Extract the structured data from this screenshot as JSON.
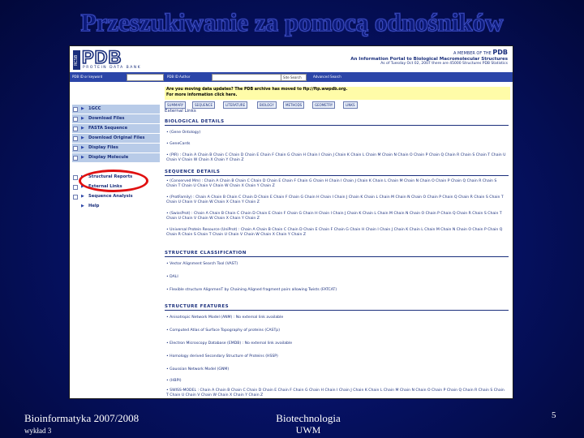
{
  "slide": {
    "title": "Przeszukiwanie za pomocą odnośników",
    "footer_left": "Bioinformatyka 2007/2008",
    "footer_left_sub": "wykład 3",
    "footer_center": "Biotechnologia",
    "footer_center_sub": "UWM",
    "page_number": "5"
  },
  "screenshot": {
    "logo_side": "RCSB",
    "logo": "PDB",
    "logo_sub": "PROTEIN DATA BANK",
    "tagline_1": "A MEMBER OF THE",
    "tagline_mark": "PDB",
    "tagline_2": "An Information Portal to Biological Macromolecular Structures",
    "links_row": "As of Tuesday Oct 02, 2007   there are 45000 Structures   PDB Statistics",
    "bluebar_site": "PDB ID or keyword",
    "bluebar_inp1": "",
    "bluebar_lbl1": "PDB ID   Author",
    "bluebar_inp2": "",
    "bluebar_btn": "Site Search",
    "bluebar_adv": "Advanced Search",
    "sidebar": [
      {
        "label": "1GCC",
        "highlight": false
      },
      {
        "label": "Download Files",
        "highlight": false
      },
      {
        "label": "FASTA Sequence",
        "highlight": false
      },
      {
        "label": "Download Original Files",
        "highlight": false
      },
      {
        "label": "Display Files",
        "highlight": false
      },
      {
        "label": "Display Molecule",
        "highlight": false
      },
      {
        "label": "Structural Reports",
        "highlight": false
      },
      {
        "label": "External Links",
        "highlight": true
      },
      {
        "label": "Sequence Analysis",
        "highlight": false
      },
      {
        "label": "Help",
        "highlight": false
      }
    ],
    "notice_1": "Are you moving data updates? The PDB archive has moved to ftp://ftp.wwpdb.org.",
    "notice_2": "For more information click here.",
    "tabs": [
      "SUMMARY",
      "SEQUENCE",
      "LITERATURE",
      "BIOLOGY",
      "METHODS",
      "GEOMETRY",
      "LINKS"
    ],
    "page_heading": "External Links",
    "sections": [
      {
        "title": "BIOLOGICAL DETAILS",
        "lines": [
          "• (Gene Ontology)",
          "• GeneCards",
          "• (PIR) : Chain A  Chain B  Chain C  Chain D  Chain E  Chain F  Chain G  Chain H  Chain I  Chain J  Chain K  Chain L  Chain M  Chain N  Chain O  Chain P  Chain Q  Chain R  Chain S  Chain T  Chain U  Chain V  Chain W  Chain X  Chain Y  Chain Z"
        ]
      },
      {
        "title": "SEQUENCE DETAILS",
        "lines": [
          "• (Conserved Mm) : Chain A  Chain B  Chain C  Chain D  Chain E  Chain F  Chain G  Chain H  Chain I  Chain J  Chain K  Chain L  Chain M  Chain N  Chain O  Chain P  Chain Q  Chain R  Chain S  Chain T  Chain U  Chain V  Chain W  Chain X  Chain Y  Chain Z",
          "• (ProtFamily) : Chain A  Chain B  Chain C  Chain D  Chain E  Chain F  Chain G  Chain H  Chain I  Chain J  Chain K  Chain L  Chain M  Chain N  Chain O  Chain P  Chain Q  Chain R  Chain S  Chain T  Chain U  Chain V  Chain W  Chain X  Chain Y  Chain Z",
          "• (SwissProt) : Chain A  Chain B  Chain C  Chain D  Chain E  Chain F  Chain G  Chain H  Chain I  Chain J  Chain K  Chain L  Chain M  Chain N  Chain O  Chain P  Chain Q  Chain R  Chain S  Chain T  Chain U  Chain V  Chain W  Chain X  Chain Y  Chain Z",
          "• Universal Protein Resource (UniProt) : Chain A  Chain B  Chain C  Chain D  Chain E  Chain F  Chain G  Chain H  Chain I  Chain J  Chain K  Chain L  Chain M  Chain N  Chain O  Chain P  Chain Q  Chain R  Chain S  Chain T  Chain U  Chain V  Chain W  Chain X  Chain Y  Chain Z"
        ]
      },
      {
        "title": "STRUCTURE CLASSIFICATION",
        "lines": [
          "• Vector Alignment Search Tool (VAST)",
          "• DALI",
          "• Flexible structure AlignmenT by Chaining Aligned fragment pairs allowing Twists (FATCAT)"
        ]
      },
      {
        "title": "STRUCTURE FEATURES",
        "lines": [
          "• Anisotropic Network Model (ANM) : No external link available",
          "• Computed Atlas of Surface Topography of proteins (CASTp)",
          "• Electron Microscopy Database (EMDB) : No external link available",
          "• Homology derived Secondary Structure of Proteins (HSSP)",
          "• Gaussian Network Model (GNM)",
          "• (HBPI)",
          "• SWISS-MODEL : Chain A  Chain B  Chain C  Chain D  Chain E  Chain F  Chain G  Chain H  Chain I  Chain J  Chain K  Chain L  Chain M  Chain N  Chain O  Chain P  Chain Q  Chain R  Chain S  Chain T  Chain U  Chain V  Chain W  Chain X  Chain Y  Chain Z"
        ]
      }
    ],
    "colors": {
      "bg": "#061266",
      "navy": "#1a2f7c",
      "sidebar": "#b8cbe8",
      "notice": "#fffca8",
      "oval": "#e01010"
    }
  }
}
